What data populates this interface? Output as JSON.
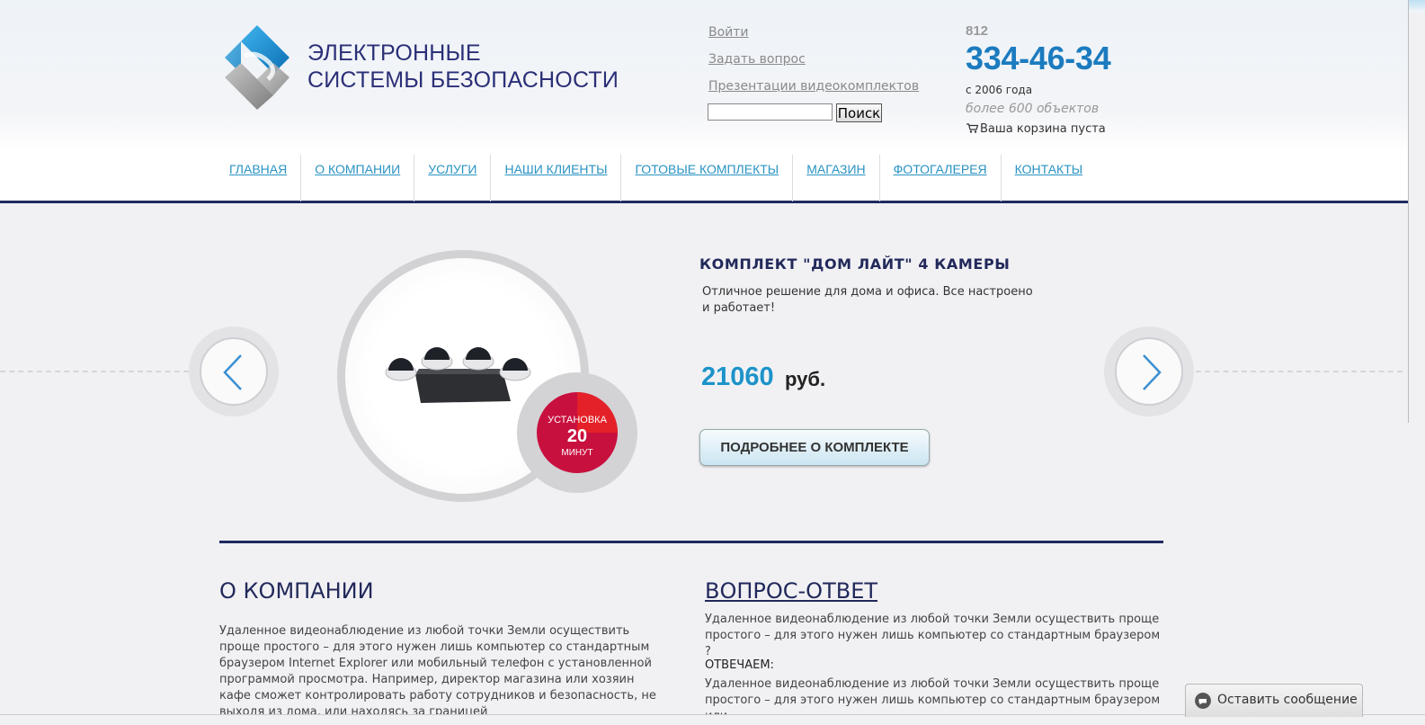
{
  "logo": {
    "line1": "ЭЛЕКТРОННЫЕ",
    "line2": "СИСТЕМЫ БЕЗОПАСНОСТИ",
    "icon": "diamond-s-logo-icon"
  },
  "top_links": {
    "login": "Войти",
    "ask": "Задать вопрос",
    "presentations": "Презентации видеокомплектов"
  },
  "search": {
    "value": "",
    "button_label": "Поиск"
  },
  "contacts": {
    "phone_code": "812",
    "phone": "334-46-34",
    "since": "с 2006 года",
    "objects": "более 600 объектов",
    "cart": "Ваша корзина пуста",
    "cart_icon": "cart-icon"
  },
  "nav": {
    "items": [
      {
        "label": "ГЛАВНАЯ"
      },
      {
        "label": "О КОМПАНИИ"
      },
      {
        "label": "УСЛУГИ"
      },
      {
        "label": "НАШИ КЛИЕНТЫ"
      },
      {
        "label": "ГОТОВЫЕ КОМПЛЕКТЫ"
      },
      {
        "label": "МАГАЗИН"
      },
      {
        "label": "ФОТОГАЛЕРЕЯ"
      },
      {
        "label": "КОНТАКТЫ"
      }
    ]
  },
  "slider": {
    "prev_icon": "chevron-left-icon",
    "next_icon": "chevron-right-icon",
    "product_image": "camera-kit-image",
    "badge": {
      "line1": "УСТАНОВКА",
      "line2": "20",
      "line3": "МИНУТ"
    },
    "title": "КОМПЛЕКТ \"ДОМ ЛАЙТ\" 4 КАМЕРЫ",
    "description": "Отличное решение для дома и офиса. Все настроено и работает!",
    "price": "21060",
    "currency": "руб.",
    "more_button": "ПОДРОБНЕЕ О КОМПЛЕКТЕ"
  },
  "about": {
    "title": "О КОМПАНИИ",
    "text": "Удаленное видеонаблюдение из любой точки Земли осуществить проще простого – для этого нужен лишь компьютер со стандартным браузером Internet Explorer или мобильный телефон с установленной программой просмотра. Например, директор магазина или хозяин кафе сможет контролировать работу сотрудников и безопасность, не выходя из дома, или находясь за границей"
  },
  "qa": {
    "title": "ВОПРОС-ОТВЕТ",
    "question": "Удаленное видеонаблюдение из любой точки Земли осуществить проще простого – для этого нужен лишь компьютер со стандартным браузером ?",
    "answer_label": "ОТВЕЧАЕМ:",
    "answer": "Удаленное видеонаблюдение из любой точки Земли осуществить проще простого – для этого нужен лишь компьютер со стандартным браузером или"
  },
  "chat": {
    "label": "Оставить сообщение",
    "icon": "chat-bubble-icon"
  },
  "colors": {
    "accent": "#1c7bbf",
    "dark": "#1e2b5e",
    "badge": "#c8103e"
  }
}
